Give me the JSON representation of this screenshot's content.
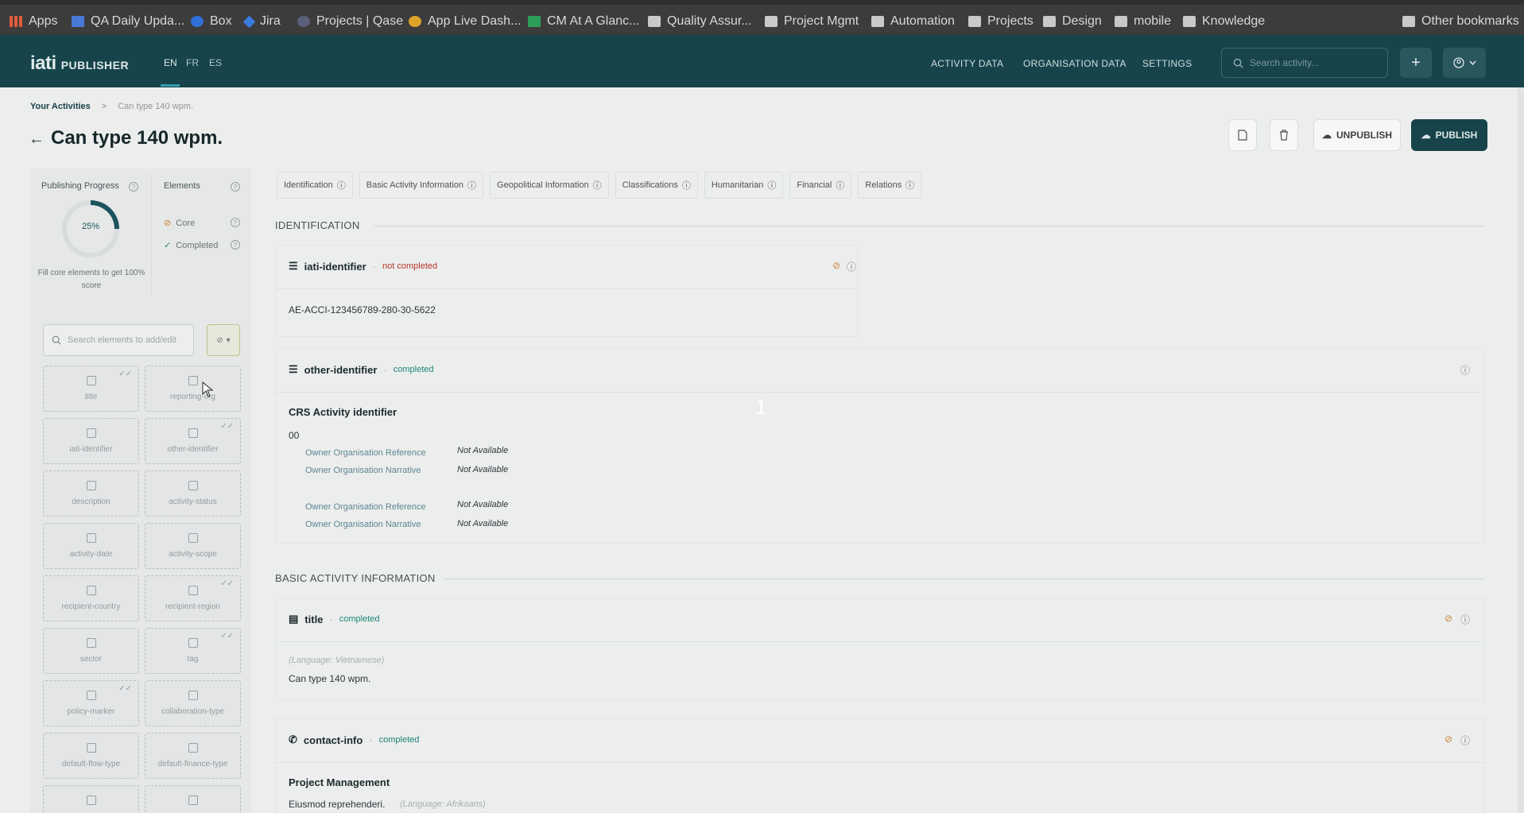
{
  "browser": {
    "bookmarks": [
      {
        "label": "Apps",
        "icon": "apps-grid-icon"
      },
      {
        "label": "QA Daily Upda...",
        "icon": "doc-icon"
      },
      {
        "label": "Box",
        "icon": "box-icon"
      },
      {
        "label": "Jira",
        "icon": "jira-icon"
      },
      {
        "label": "Projects | Qase",
        "icon": "qase-icon"
      },
      {
        "label": "App Live Dash...",
        "icon": "dashboard-icon"
      },
      {
        "label": "CM At A Glanc...",
        "icon": "sheet-icon"
      },
      {
        "label": "Quality Assur...",
        "icon": "folder-icon"
      },
      {
        "label": "Project Mgmt",
        "icon": "folder-icon"
      },
      {
        "label": "Automation",
        "icon": "folder-icon"
      },
      {
        "label": "Projects",
        "icon": "folder-icon"
      },
      {
        "label": "Design",
        "icon": "folder-icon"
      },
      {
        "label": "mobile",
        "icon": "folder-icon"
      },
      {
        "label": "Knowledge",
        "icon": "folder-icon"
      },
      {
        "label": "Other bookmarks",
        "icon": "folder-icon"
      }
    ]
  },
  "header": {
    "logo": "iati",
    "logo_sub": "PUBLISHER",
    "languages": [
      "EN",
      "FR",
      "ES"
    ],
    "active_language": "EN",
    "nav": [
      "ACTIVITY DATA",
      "ORGANISATION DATA",
      "SETTINGS"
    ],
    "search_placeholder": "Search activity...",
    "add_label": "+"
  },
  "breadcrumb": {
    "root": "Your Activities",
    "separator": ">",
    "current": "Can type 140 wpm."
  },
  "page": {
    "title": "Can type 140 wpm.",
    "unpublish_label": "UNPUBLISH",
    "publish_label": "PUBLISH"
  },
  "progress": {
    "title": "Publishing Progress",
    "percent_label": "25%",
    "percent_value": 0.25,
    "note": "Fill core elements to get 100% score"
  },
  "elements": {
    "title": "Elements",
    "legend": [
      {
        "label": "Core"
      },
      {
        "label": "Completed"
      }
    ],
    "search_placeholder": "Search elements to add/edit",
    "tiles": [
      {
        "label": "title",
        "checked": true
      },
      {
        "label": "reporting-org",
        "checked": false
      },
      {
        "label": "iati-identifier",
        "checked": false
      },
      {
        "label": "other-identifier",
        "checked": true
      },
      {
        "label": "description",
        "checked": false
      },
      {
        "label": "activity-status",
        "checked": false
      },
      {
        "label": "activity-date",
        "checked": false
      },
      {
        "label": "activity-scope",
        "checked": false
      },
      {
        "label": "recipient-country",
        "checked": false
      },
      {
        "label": "recipient-region",
        "checked": true
      },
      {
        "label": "sector",
        "checked": false
      },
      {
        "label": "tag",
        "checked": true
      },
      {
        "label": "policy-marker",
        "checked": true
      },
      {
        "label": "collaboration-type",
        "checked": false
      },
      {
        "label": "default-flow-type",
        "checked": false
      },
      {
        "label": "default-finance-type",
        "checked": false
      },
      {
        "label": "",
        "checked": false
      },
      {
        "label": "",
        "checked": false
      }
    ]
  },
  "tabs": [
    "Identification",
    "Basic Activity Information",
    "Geopolitical Information",
    "Classifications",
    "Humanitarian",
    "Financial",
    "Relations"
  ],
  "sections": {
    "identification": {
      "heading": "IDENTIFICATION",
      "iati_identifier": {
        "name": "iati-identifier",
        "status": "not completed",
        "value": "AE-ACCI-123456789-280-30-5622"
      },
      "other_identifier": {
        "name": "other-identifier",
        "status": "completed",
        "subheading": "CRS Activity identifier",
        "code": "00",
        "rows": [
          {
            "key": "Owner Organisation Reference",
            "value": "Not Available"
          },
          {
            "key": "Owner Organisation Narrative",
            "value": "Not Available"
          },
          {
            "key": "Owner Organisation Reference",
            "value": "Not Available"
          },
          {
            "key": "Owner Organisation Narrative",
            "value": "Not Available"
          }
        ]
      }
    },
    "basic": {
      "heading": "BASIC ACTIVITY INFORMATION",
      "title_card": {
        "name": "title",
        "status": "completed",
        "language": "(Language: Vietnamese)",
        "value": "Can type 140 wpm."
      },
      "contact_card": {
        "name": "contact-info",
        "status": "completed",
        "subheading": "Project Management",
        "value": "Eiusmod reprehenderi.",
        "language": "(Language: Afrikaans)"
      }
    }
  },
  "overlay": {
    "number": "1"
  }
}
